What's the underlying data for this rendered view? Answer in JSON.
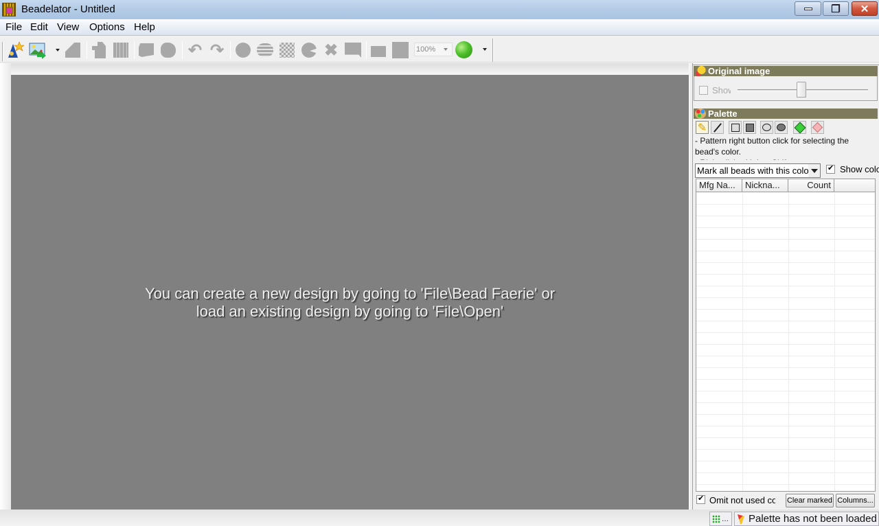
{
  "window": {
    "title": "Beadelator - Untitled",
    "controls": {
      "minimize": "—",
      "restore": "❐",
      "close": "✕"
    }
  },
  "menu": [
    "File",
    "Edit",
    "View",
    "Options",
    "Help"
  ],
  "toolbar": {
    "buttons": [
      {
        "name": "bead-faerie-new",
        "icon": "wizard-hat-star-icon",
        "enabled": true
      },
      {
        "name": "open-image",
        "icon": "picture-arrow-icon",
        "enabled": true
      },
      {
        "name": "crop",
        "icon": "crop-icon",
        "enabled": false
      },
      {
        "name": "export",
        "icon": "export-page-icon",
        "enabled": false
      },
      {
        "name": "import-grid",
        "icon": "grid-import-icon",
        "enabled": false
      },
      {
        "name": "select-area",
        "icon": "select-area-icon",
        "enabled": false
      },
      {
        "name": "lasso",
        "icon": "lasso-icon",
        "enabled": false
      },
      {
        "name": "undo",
        "icon": "undo-icon",
        "enabled": false
      },
      {
        "name": "redo",
        "icon": "redo-icon",
        "enabled": false
      },
      {
        "name": "bead",
        "icon": "circle-bead-icon",
        "enabled": false
      },
      {
        "name": "bead-strand",
        "icon": "bead-strand-icon",
        "enabled": false
      },
      {
        "name": "pattern-fill",
        "icon": "checker-icon",
        "enabled": false
      },
      {
        "name": "pacman",
        "icon": "pacman-shape-icon",
        "enabled": false
      },
      {
        "name": "scatter",
        "icon": "scatter-icon",
        "enabled": false
      },
      {
        "name": "comment",
        "icon": "speech-box-icon",
        "enabled": false
      },
      {
        "name": "folder",
        "icon": "folder-icon",
        "enabled": false
      },
      {
        "name": "square",
        "icon": "square-icon",
        "enabled": false
      }
    ],
    "zoom_value": "100%",
    "status_indicator_color": "#4fc02c"
  },
  "canvas": {
    "message_line1": "You can create a new design by going to 'File\\Bead Faerie' or",
    "message_line2": "load an existing design by going to 'File\\Open'"
  },
  "original_image": {
    "title": "Original image",
    "show_label": "Show",
    "show_checked": false,
    "slider_value_percent": 48
  },
  "palette": {
    "title": "Palette",
    "tools": [
      "pencil-icon",
      "thin-pencil-icon",
      "square-outline-icon",
      "square-filled-icon",
      "circle-outline-icon",
      "circle-filled-icon",
      "paint-bucket-icon",
      "eraser-icon"
    ],
    "hint_line1": "- Pattern right button click for selecting the",
    "hint_line2": "bead's color.",
    "hint_line3": "- Right click with key Shift opens context",
    "mark_combo_value": "Mark all beads with this color",
    "show_colors_label": "Show colors",
    "show_colors_checked": true,
    "columns": [
      "Mfg Na...",
      "Nickna...",
      "Count",
      ""
    ],
    "rows": [],
    "omit_label": "Omit not used colors",
    "omit_checked": true,
    "clear_marked_label": "Clear marked",
    "columns_button_label": "Columns..."
  },
  "statusbar": {
    "grid_pane": "...",
    "message": "Palette has not been loaded"
  }
}
